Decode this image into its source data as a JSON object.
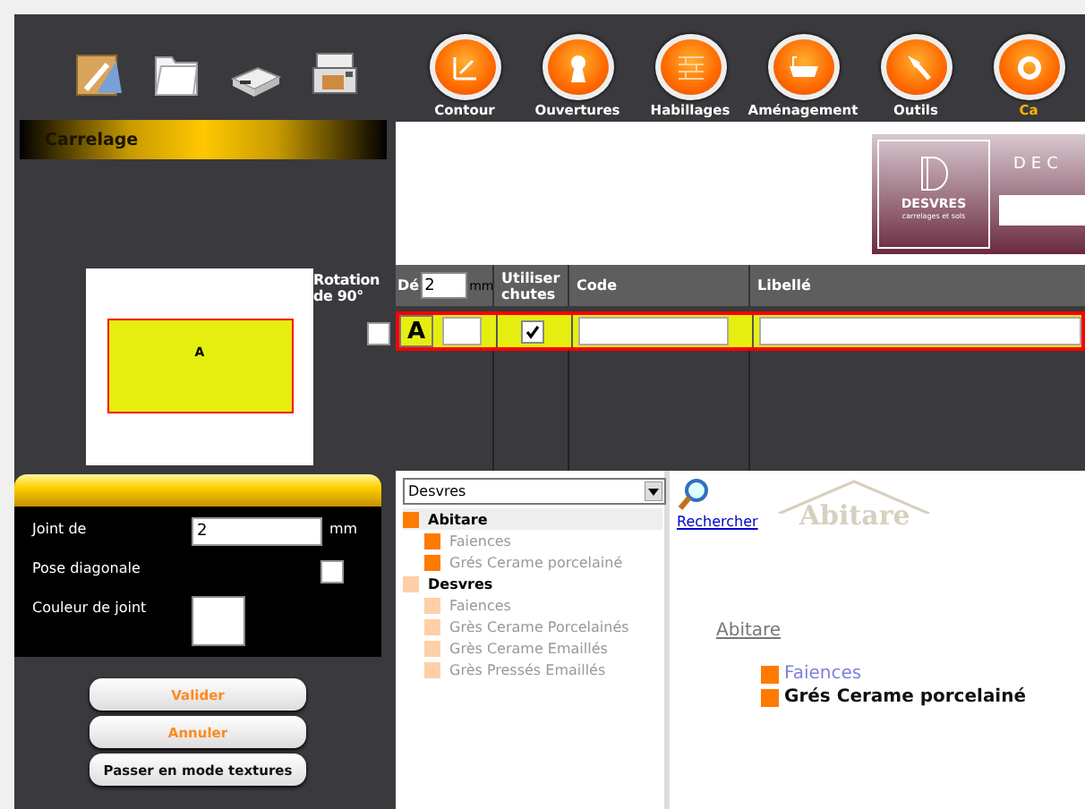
{
  "nav": [
    {
      "label": "Contour",
      "selected": false
    },
    {
      "label": "Ouvertures",
      "selected": false
    },
    {
      "label": "Habillages",
      "selected": false
    },
    {
      "label": "Aménagement",
      "selected": false
    },
    {
      "label": "Outils",
      "selected": false
    },
    {
      "label": "Ca",
      "selected": true
    }
  ],
  "section_title": "Carrelage",
  "banner": {
    "brand": "DESVRES",
    "tagline": "carrelages et sols",
    "title": "DEC"
  },
  "preview": {
    "tile_label": "A"
  },
  "rotation": {
    "label": "Rotation de 90°",
    "checked": false
  },
  "grid": {
    "columns": [
      "Dé",
      "Utiliser chutes",
      "Code",
      "Libellé"
    ],
    "offset": {
      "value": "2",
      "unit": "mm"
    },
    "rows": [
      {
        "tile": "A",
        "use_offcuts": true,
        "selected": true
      }
    ]
  },
  "joint": {
    "fields": [
      {
        "kind": "number",
        "label": "Joint de",
        "value": "2",
        "unit": "mm"
      },
      {
        "kind": "checkbox",
        "label": "Pose diagonale",
        "checked": false
      },
      {
        "kind": "color",
        "label": "Couleur de joint"
      }
    ]
  },
  "buttons": [
    {
      "label": "Valider",
      "kind": "primary"
    },
    {
      "label": "Annuler",
      "kind": "primary"
    },
    {
      "label": "Passer en mode textures",
      "kind": "secondary"
    }
  ],
  "catalog": {
    "brand_select": "Desvres",
    "tree": [
      {
        "label": "Abitare",
        "selected": true,
        "color": "#ff7a00",
        "children": [
          {
            "label": "Faiences",
            "selected": false,
            "color": "#ff7a00"
          },
          {
            "label": "Grés Cerame porcelainé",
            "selected": false,
            "color": "#ff7a00"
          }
        ]
      },
      {
        "label": "Desvres",
        "selected": false,
        "color": "#ffcfa8",
        "children": [
          {
            "label": "Faiences",
            "selected": false,
            "color": "#ffcfa8"
          },
          {
            "label": "Grès Cerame Porcelainés",
            "selected": false,
            "color": "#ffcfa8"
          },
          {
            "label": "Grès Cerame Emaillés",
            "selected": false,
            "color": "#ffcfa8"
          },
          {
            "label": "Grès Pressés Emaillés",
            "selected": false,
            "color": "#ffcfa8"
          }
        ]
      }
    ],
    "search_link": "Rechercher",
    "logo": "Abitare",
    "heading": "Abitare",
    "items": [
      {
        "label": "Faiences",
        "kind": "link"
      },
      {
        "label": "Grés Cerame porcelainé",
        "kind": "bold"
      }
    ]
  }
}
